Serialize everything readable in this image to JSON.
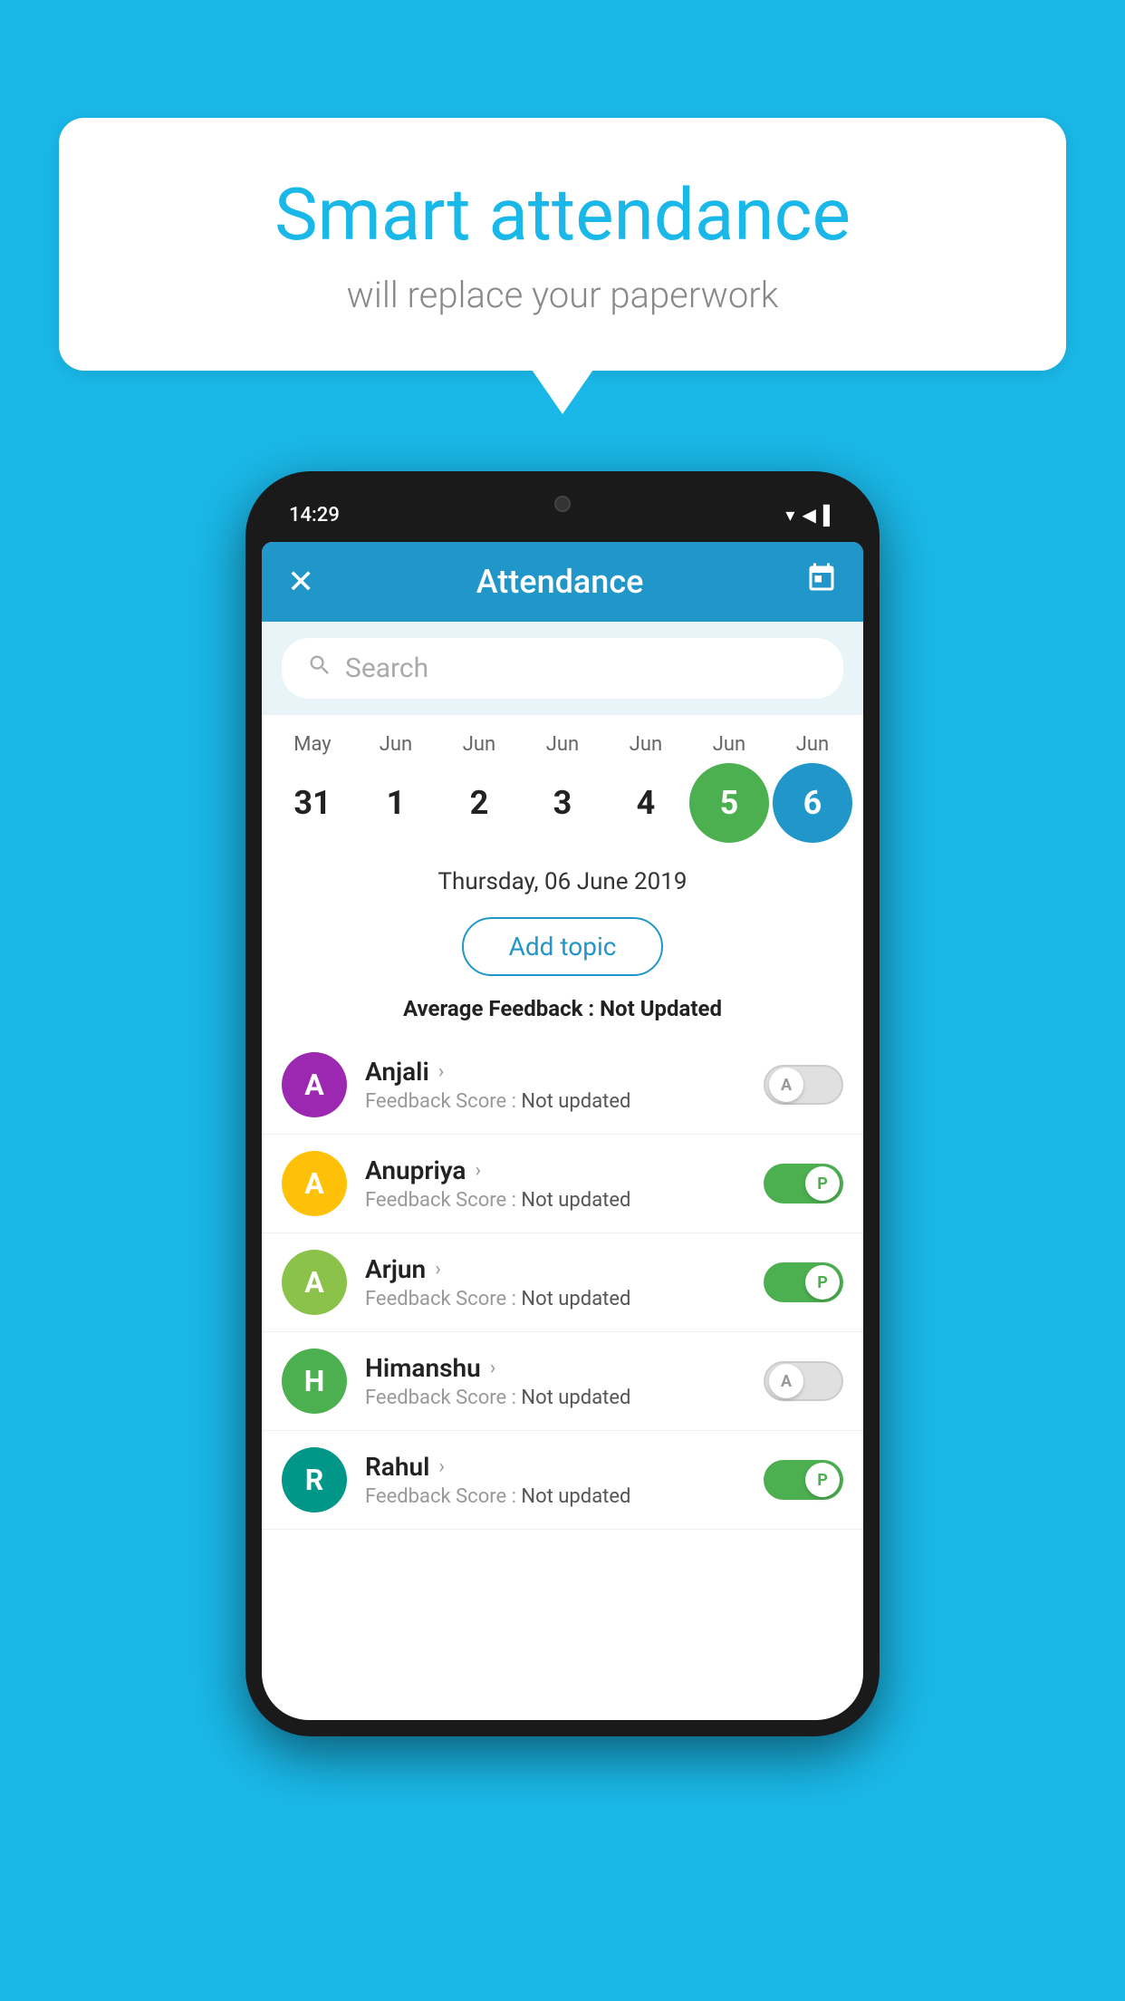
{
  "background_color": "#1AB8E8",
  "bubble": {
    "title": "Smart attendance",
    "subtitle": "will replace your paperwork"
  },
  "phone": {
    "status_bar": {
      "time": "14:29",
      "icons": [
        "wifi",
        "signal",
        "battery"
      ]
    },
    "header": {
      "title": "Attendance",
      "close_label": "✕",
      "calendar_label": "📅"
    },
    "search": {
      "placeholder": "Search"
    },
    "calendar": {
      "months": [
        "May",
        "Jun",
        "Jun",
        "Jun",
        "Jun",
        "Jun",
        "Jun"
      ],
      "days": [
        "31",
        "1",
        "2",
        "3",
        "4",
        "5",
        "6"
      ],
      "selected_green_index": 5,
      "selected_blue_index": 6
    },
    "selected_date": "Thursday, 06 June 2019",
    "add_topic_label": "Add topic",
    "feedback_info": {
      "label": "Average Feedback : ",
      "value": "Not Updated"
    },
    "students": [
      {
        "name": "Anjali",
        "avatar_letter": "A",
        "avatar_color": "av-purple",
        "feedback": "Feedback Score : Not updated",
        "toggle": "off",
        "toggle_letter": "A"
      },
      {
        "name": "Anupriya",
        "avatar_letter": "A",
        "avatar_color": "av-yellow",
        "feedback": "Feedback Score : Not updated",
        "toggle": "on",
        "toggle_letter": "P"
      },
      {
        "name": "Arjun",
        "avatar_letter": "A",
        "avatar_color": "av-green-light",
        "feedback": "Feedback Score : Not updated",
        "toggle": "on",
        "toggle_letter": "P"
      },
      {
        "name": "Himanshu",
        "avatar_letter": "H",
        "avatar_color": "av-green-dark",
        "feedback": "Feedback Score : Not updated",
        "toggle": "off",
        "toggle_letter": "A"
      },
      {
        "name": "Rahul",
        "avatar_letter": "R",
        "avatar_color": "av-teal",
        "feedback": "Feedback Score : Not updated",
        "toggle": "on",
        "toggle_letter": "P"
      }
    ]
  }
}
